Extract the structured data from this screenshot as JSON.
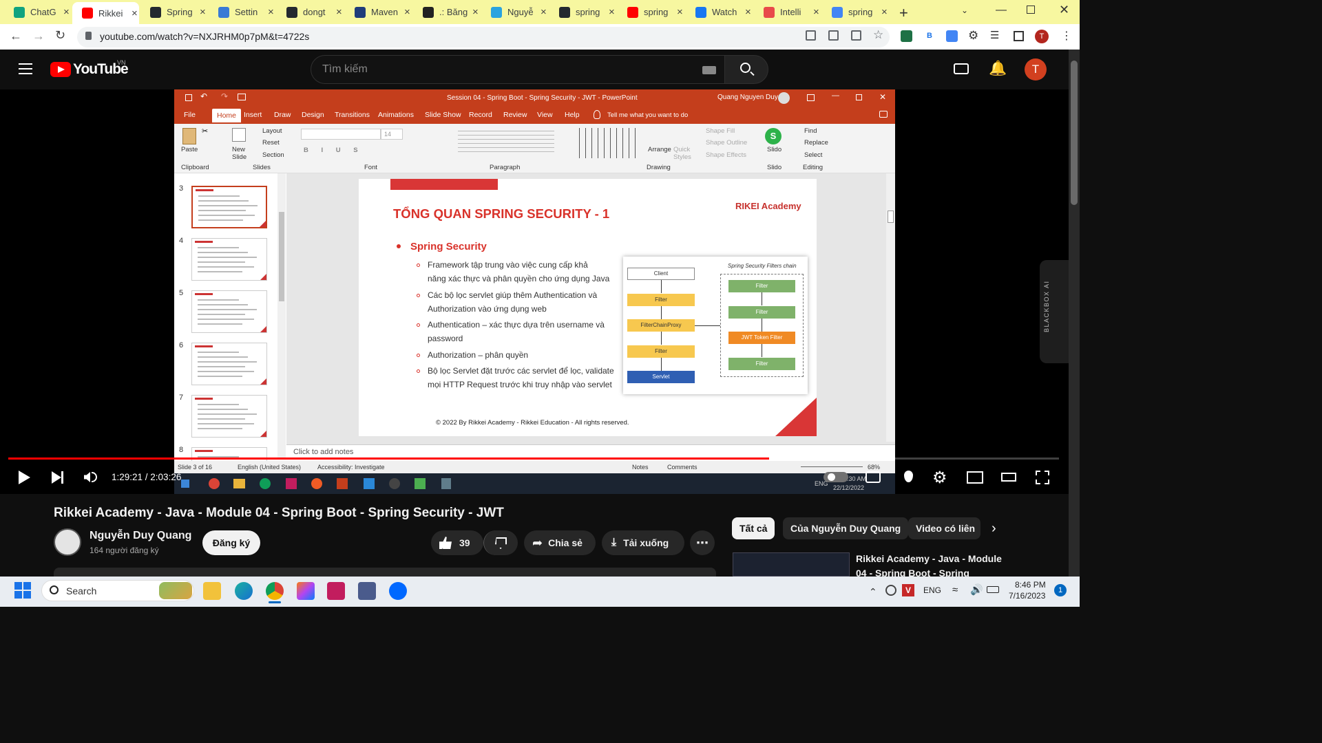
{
  "browser": {
    "tabs": [
      {
        "title": "ChatG",
        "icon": "chatgpt-icon",
        "color": "#10a37f"
      },
      {
        "title": "Rikkei",
        "icon": "youtube-icon",
        "color": "#ff0000",
        "active": true
      },
      {
        "title": "Spring",
        "icon": "github-icon",
        "color": "#24292f"
      },
      {
        "title": "Settin",
        "icon": "gear-icon",
        "color": "#3a7bd5"
      },
      {
        "title": "dongt",
        "icon": "github-icon",
        "color": "#24292f"
      },
      {
        "title": "Maven",
        "icon": "maven-icon",
        "color": "#1f3d7a"
      },
      {
        "title": ".: Băng",
        "icon": "globe-icon",
        "color": "#222"
      },
      {
        "title": "Nguyễ",
        "icon": "telegram-icon",
        "color": "#2aa3df"
      },
      {
        "title": "spring",
        "icon": "github-icon",
        "color": "#24292f"
      },
      {
        "title": "spring",
        "icon": "youtube-icon",
        "color": "#ff0000"
      },
      {
        "title": "Watch",
        "icon": "facebook-icon",
        "color": "#1877f2"
      },
      {
        "title": "Intelli",
        "icon": "intellij-icon",
        "color": "#e84a4a"
      },
      {
        "title": "spring",
        "icon": "google-icon",
        "color": "#4285f4"
      }
    ],
    "url": "youtube.com/watch?v=NXJRHM0p7pM&t=4722s",
    "profile_initial": "T",
    "ext_b_label": "B"
  },
  "youtube": {
    "logo": "YouTube",
    "region": "VN",
    "search_placeholder": "Tìm kiếm",
    "avatar_initial": "T",
    "time_display": "1:29:21 / 2:03:26",
    "progress_fraction": 0.724,
    "video_title": "Rikkei Academy - Java - Module 04 - Spring Boot - Spring Security - JWT",
    "channel_name": "Nguyễn Duy Quang",
    "subscribers": "164 người đăng ký",
    "subscribe_label": "Đăng ký",
    "likes": "39",
    "share_label": "Chia sẻ",
    "download_label": "Tải xuống",
    "chips": [
      "Tất cả",
      "Của Nguyễn Duy Quang",
      "Video có liên"
    ],
    "related_title_1": "Rikkei Academy - Java - Module",
    "related_title_2": "04 - Spring Boot - Spring"
  },
  "ppt": {
    "window_title": "Session 04 - Spring Boot - Spring Security - JWT  -  PowerPoint",
    "user": "Quang Nguyen Duy",
    "menu": [
      "File",
      "Home",
      "Insert",
      "Draw",
      "Design",
      "Transitions",
      "Animations",
      "Slide Show",
      "Record",
      "Review",
      "View",
      "Help"
    ],
    "tell_me": "Tell me what you want to do",
    "ribbon": {
      "paste": "Paste",
      "new_slide": "New Slide",
      "layout": "Layout",
      "reset": "Reset",
      "section": "Section",
      "font_size": "14",
      "arrange": "Arrange",
      "quick_styles": "Quick Styles",
      "shape_fill": "Shape Fill",
      "shape_outline": "Shape Outline",
      "shape_effects": "Shape Effects",
      "slido": "Slido",
      "find": "Find",
      "replace": "Replace",
      "select": "Select",
      "groups": [
        "Clipboard",
        "Slides",
        "Font",
        "Paragraph",
        "Drawing",
        "Slido",
        "Editing"
      ]
    },
    "thumb_numbers": [
      "3",
      "4",
      "5",
      "6",
      "7",
      "8"
    ],
    "slide": {
      "title": "TỔNG QUAN SPRING SECURITY - 1",
      "logo": "RIKEI Academy",
      "heading": "Spring Security",
      "bullets": [
        [
          "Framework tập trung vào việc cung cấp khả",
          "năng xác thực và phân quyền cho ứng dụng Java"
        ],
        [
          "Các bộ lọc servlet giúp thêm Authentication và",
          "Authorization vào ứng dụng web"
        ],
        [
          "Authentication – xác thực dựa trên username và",
          "password"
        ],
        [
          "Authorization – phân quyền"
        ],
        [
          "Bộ lọc Servlet đặt trước các servlet để lọc, validate",
          "mọi HTTP Request trước khi truy nhập vào servlet"
        ]
      ],
      "footer": "© 2022 By Rikkei Academy - Rikkei Education - All rights reserved.",
      "diagram": {
        "chain_title": "Spring Security Filters chain",
        "left": [
          "Client",
          "Filter",
          "FilterChainProxy",
          "Filter",
          "Servlet"
        ],
        "right": [
          "Filter",
          "Filter",
          "JWT Token Filter",
          "Filter"
        ]
      }
    },
    "notes_placeholder": "Click to add notes",
    "status": {
      "slide_of": "Slide 3 of 16",
      "language": "English (United States)",
      "accessibility": "Accessibility: Investigate",
      "notes": "Notes",
      "comments": "Comments",
      "zoom": "68%"
    },
    "inner_clock_time": "1:30 AM",
    "inner_clock_date": "22/12/2022",
    "inner_lang": "ENG"
  },
  "blackbox": "BLACKBOX AI",
  "taskbar": {
    "search": "Search",
    "lang": "ENG",
    "time": "8:46 PM",
    "date": "7/16/2023",
    "notif_count": "1"
  }
}
